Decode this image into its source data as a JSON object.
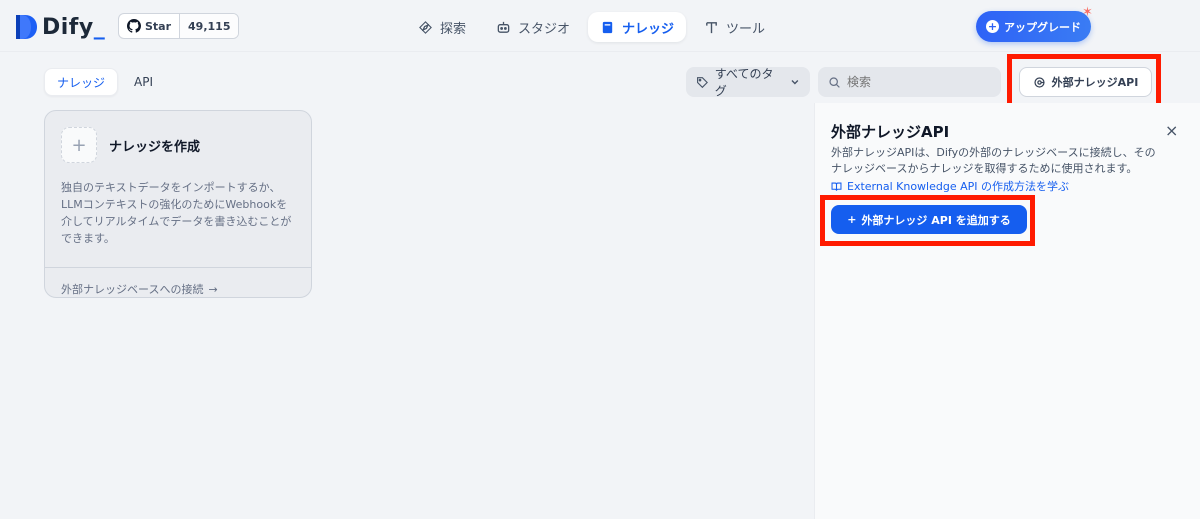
{
  "header": {
    "logo_text": "Dify",
    "github": {
      "star_label": "Star",
      "star_count": "49,115"
    },
    "nav": [
      {
        "label": "探索",
        "icon": "compass-icon"
      },
      {
        "label": "スタジオ",
        "icon": "robot-icon"
      },
      {
        "label": "ナレッジ",
        "icon": "book-icon",
        "active": true
      },
      {
        "label": "ツール",
        "icon": "hammer-icon"
      }
    ],
    "upgrade_label": "アップグレード"
  },
  "toolbar": {
    "tabs": [
      {
        "label": "ナレッジ",
        "active": true
      },
      {
        "label": "API"
      }
    ],
    "tag_filter_label": "すべてのタグ",
    "search_placeholder": "検索",
    "external_api_button": "外部ナレッジAPI"
  },
  "create_card": {
    "plus": "+",
    "title": "ナレッジを作成",
    "description": "独自のテキストデータをインポートするか、LLMコンテキストの強化のためにWebhookを介してリアルタイムでデータを書き込むことができます。",
    "link": "外部ナレッジベースへの接続",
    "link_arrow": "→"
  },
  "panel": {
    "title": "外部ナレッジAPI",
    "close": "×",
    "description": "外部ナレッジAPIは、Difyの外部のナレッジベースに接続し、そのナレッジベースからナレッジを取得するために使用されます。",
    "learn_link": "External Knowledge API の作成方法を学ぶ",
    "add_button": "外部ナレッジ API を追加する"
  },
  "colors": {
    "accent": "#155eef",
    "highlight": "#ff1a00",
    "background": "#f2f4f7"
  }
}
